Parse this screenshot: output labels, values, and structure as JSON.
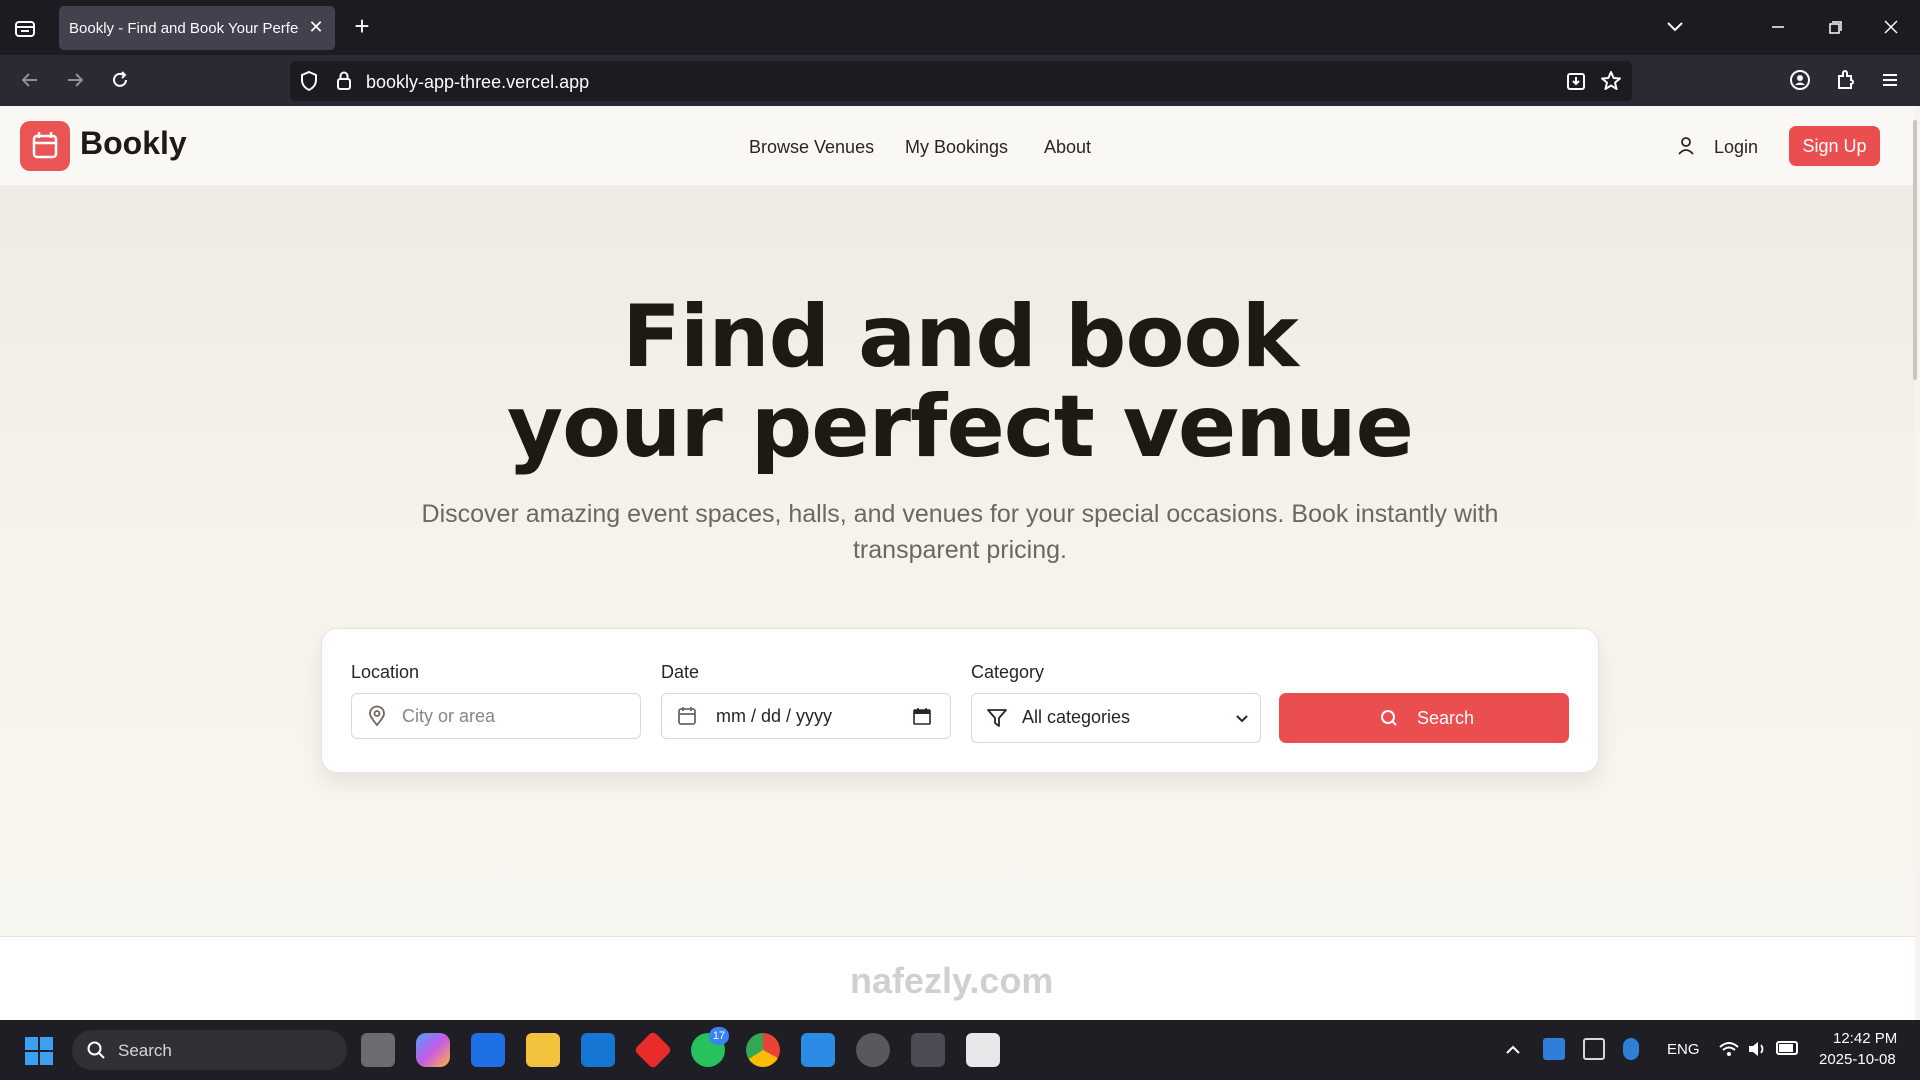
{
  "browser": {
    "tab_title": "Bookly - Find and Book Your Perfect Venue",
    "url": "bookly-app-three.vercel.app"
  },
  "site": {
    "brand": "Bookly",
    "brand_color": "#ea4e4e",
    "nav_links": [
      "Browse Venues",
      "My Bookings",
      "About"
    ],
    "login_label": "Login",
    "signup_label": "Sign Up"
  },
  "hero": {
    "title_line1": "Find and book",
    "title_line2": "your perfect venue",
    "subtitle_line1": "Discover amazing event spaces, halls, and venues for your special occasions. Book instantly with",
    "subtitle_line2": "transparent pricing."
  },
  "search_form": {
    "location_label": "Location",
    "location_placeholder": "City or area",
    "date_label": "Date",
    "date_placeholder": "mm / dd / yyyy",
    "category_label": "Category",
    "category_value": "All categories",
    "search_label": "Search"
  },
  "taskbar": {
    "search_placeholder": "Search",
    "badge_count": "17",
    "language": "ENG",
    "time": "12:42 PM",
    "date": "2025-10-08"
  },
  "watermark": "nafezly.com"
}
